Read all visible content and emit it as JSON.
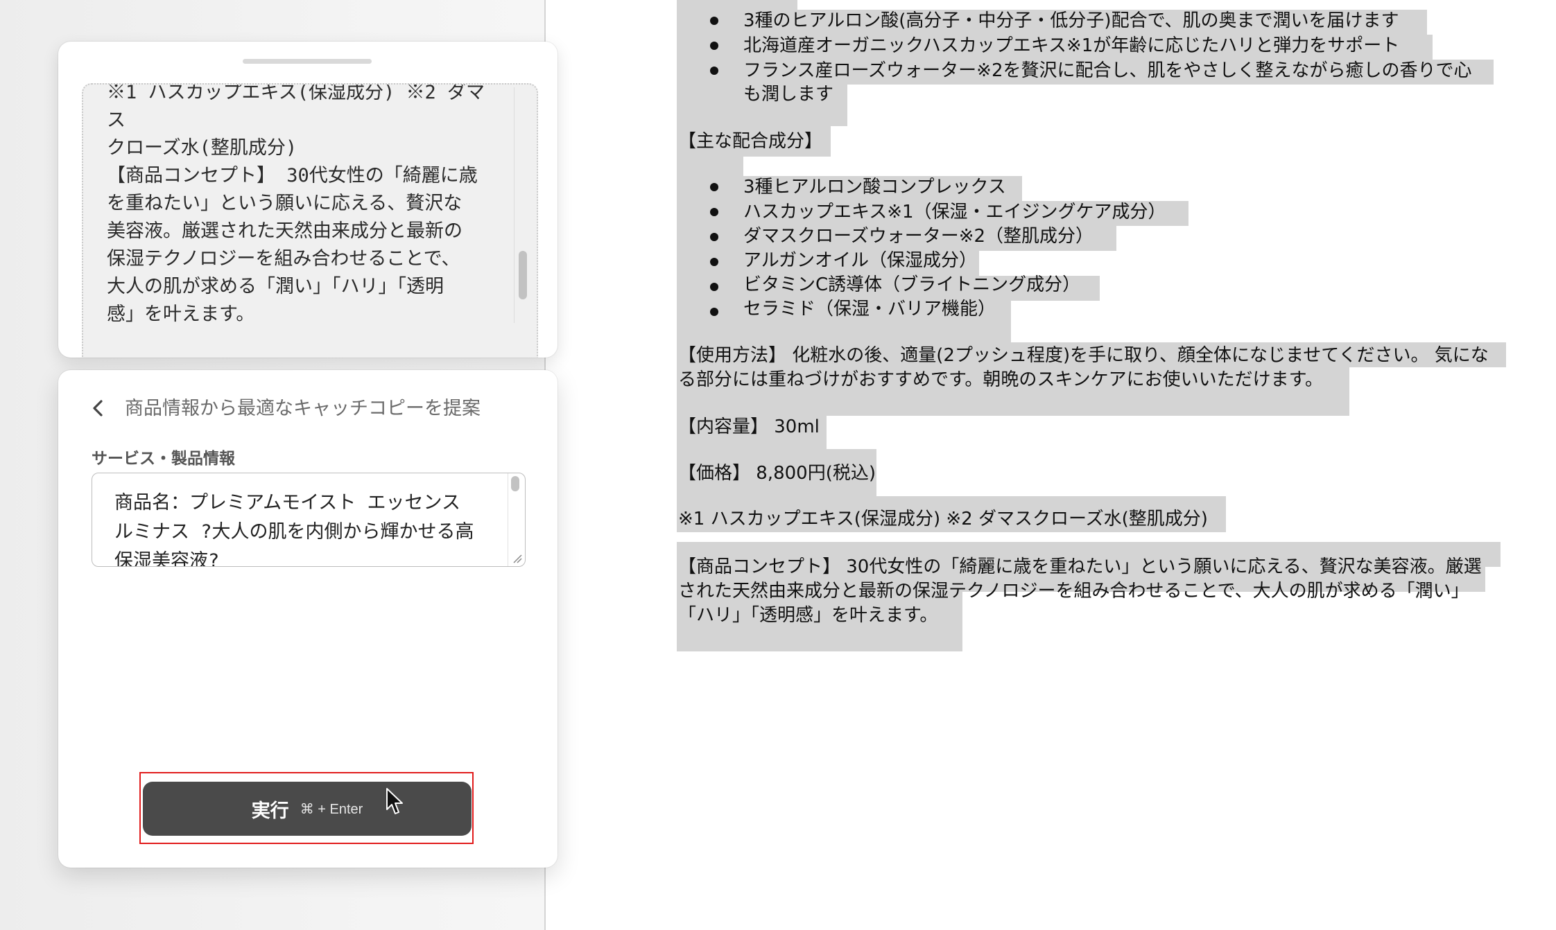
{
  "preview": {
    "text": "※1 ハスカップエキス(保湿成分) ※2 ダマス\nクローズ水(整肌成分)\n【商品コンセプト】 30代女性の「綺麗に歳\nを重ねたい」という願いに応える、贅沢な\n美容液。厳選された天然由来成分と最新の\n保湿テクノロジーを組み合わせることで、\n大人の肌が求める「潤い」「ハリ」「透明\n感」を叶えます。"
  },
  "panel": {
    "title": "商品情報から最適なキャッチコピーを提案",
    "field_label": "サービス・製品情報",
    "input_value": "商品名：プレミアムモイスト エッセンス\nルミナス ?大人の肌を内側から輝かせる高\n保湿美容液?",
    "run_label": "実行",
    "run_shortcut": "⌘ + Enter"
  },
  "document": {
    "bullets_top": [
      "3種のヒアルロン酸(高分子・中分子・低分子)配合で、肌の奥まで潤いを届けます",
      "北海道産オーガニックハスカップエキス※1が年齢に応じたハリと弾力をサポート",
      "フランス産ローズウォーター※2を贅沢に配合し、肌をやさしく整えながら癒しの香りで心",
      "も潤します"
    ],
    "ingredients_heading": "【主な配合成分】",
    "ingredients": [
      "3種ヒアルロン酸コンプレックス",
      "ハスカップエキス※1（保湿・エイジングケア成分）",
      "ダマスクローズウォーター※2（整肌成分）",
      "アルガンオイル（保湿成分）",
      "ビタミンC誘導体（ブライトニング成分）",
      "セラミド（保湿・バリア機能）"
    ],
    "usage_line1": "【使用方法】 化粧水の後、適量(2プッシュ程度)を手に取り、顔全体になじませてください。 気にな",
    "usage_line2": "る部分には重ねづけがおすすめです。朝晩のスキンケアにお使いいただけます。",
    "volume": "【内容量】 30ml",
    "price": "【価格】 8,800円(税込)",
    "notes": "※1 ハスカップエキス(保湿成分) ※2 ダマスクローズ水(整肌成分)",
    "concept_line1": "【商品コンセプト】 30代女性の「綺麗に歳を重ねたい」という願いに応える、贅沢な美容液。厳選",
    "concept_line2": "された天然由来成分と最新の保湿テクノロジーを組み合わせることで、大人の肌が求める「潤い」",
    "concept_line3": "「ハリ」「透明感」を叶えます。"
  }
}
